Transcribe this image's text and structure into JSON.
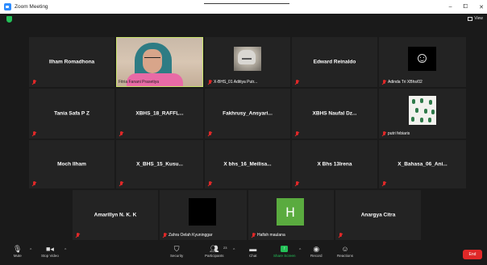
{
  "window": {
    "title": "Zoom Meeting",
    "minimize": "–",
    "maximize": "⧠",
    "close": "✕"
  },
  "topbar": {
    "view_label": "View"
  },
  "tiles": {
    "r1c1": {
      "name": "Ilham Romadhona"
    },
    "r1c2": {
      "footer": "Fitria Fanani Prasetiya"
    },
    "r1c3": {
      "footer": "X-BHS_01 Aditiya Putr..."
    },
    "r1c4": {
      "name": "Edward Reinaldo"
    },
    "r1c5": {
      "footer": "Adinda Tri XBhs/02"
    },
    "r2c1": {
      "name": "Tania Safa P Z"
    },
    "r2c2": {
      "name": "XBHS_18_RAFFL..."
    },
    "r2c3": {
      "name": "Fakhrusy_Ansyari..."
    },
    "r2c4": {
      "name": "XBHS Naufal Dz..."
    },
    "r2c5": {
      "footer": "putri febiaris"
    },
    "r3c1": {
      "name": "Moch Ilham"
    },
    "r3c2": {
      "name": "X_BHS_15_Kusu..."
    },
    "r3c3": {
      "name": "X bhs_16_Meilisa..."
    },
    "r3c4": {
      "name": "X Bhs 13Irena"
    },
    "r3c5": {
      "name": "X_Bahasa_06_Ani..."
    },
    "r4c1": {
      "name": "Amarillyn N. K. K"
    },
    "r4c2": {
      "footer": "Zahra Oelah Kyuninggar"
    },
    "r4c3": {
      "footer": "Hafish maulana",
      "avatar_letter": "H"
    },
    "r4c4": {
      "name": "Anargya Citra"
    }
  },
  "toolbar": {
    "mute": "Mute",
    "stop_video": "Stop Video",
    "security": "Security",
    "participants": "Participants",
    "participants_count": "23",
    "chat": "Chat",
    "share_screen": "Share Screen",
    "record": "Record",
    "reactions": "Reactions",
    "end": "End"
  },
  "colors": {
    "accent_green": "#23c057",
    "zoom_blue": "#2d8cff",
    "end_red": "#e02828",
    "active_border": "#c8e26b"
  }
}
